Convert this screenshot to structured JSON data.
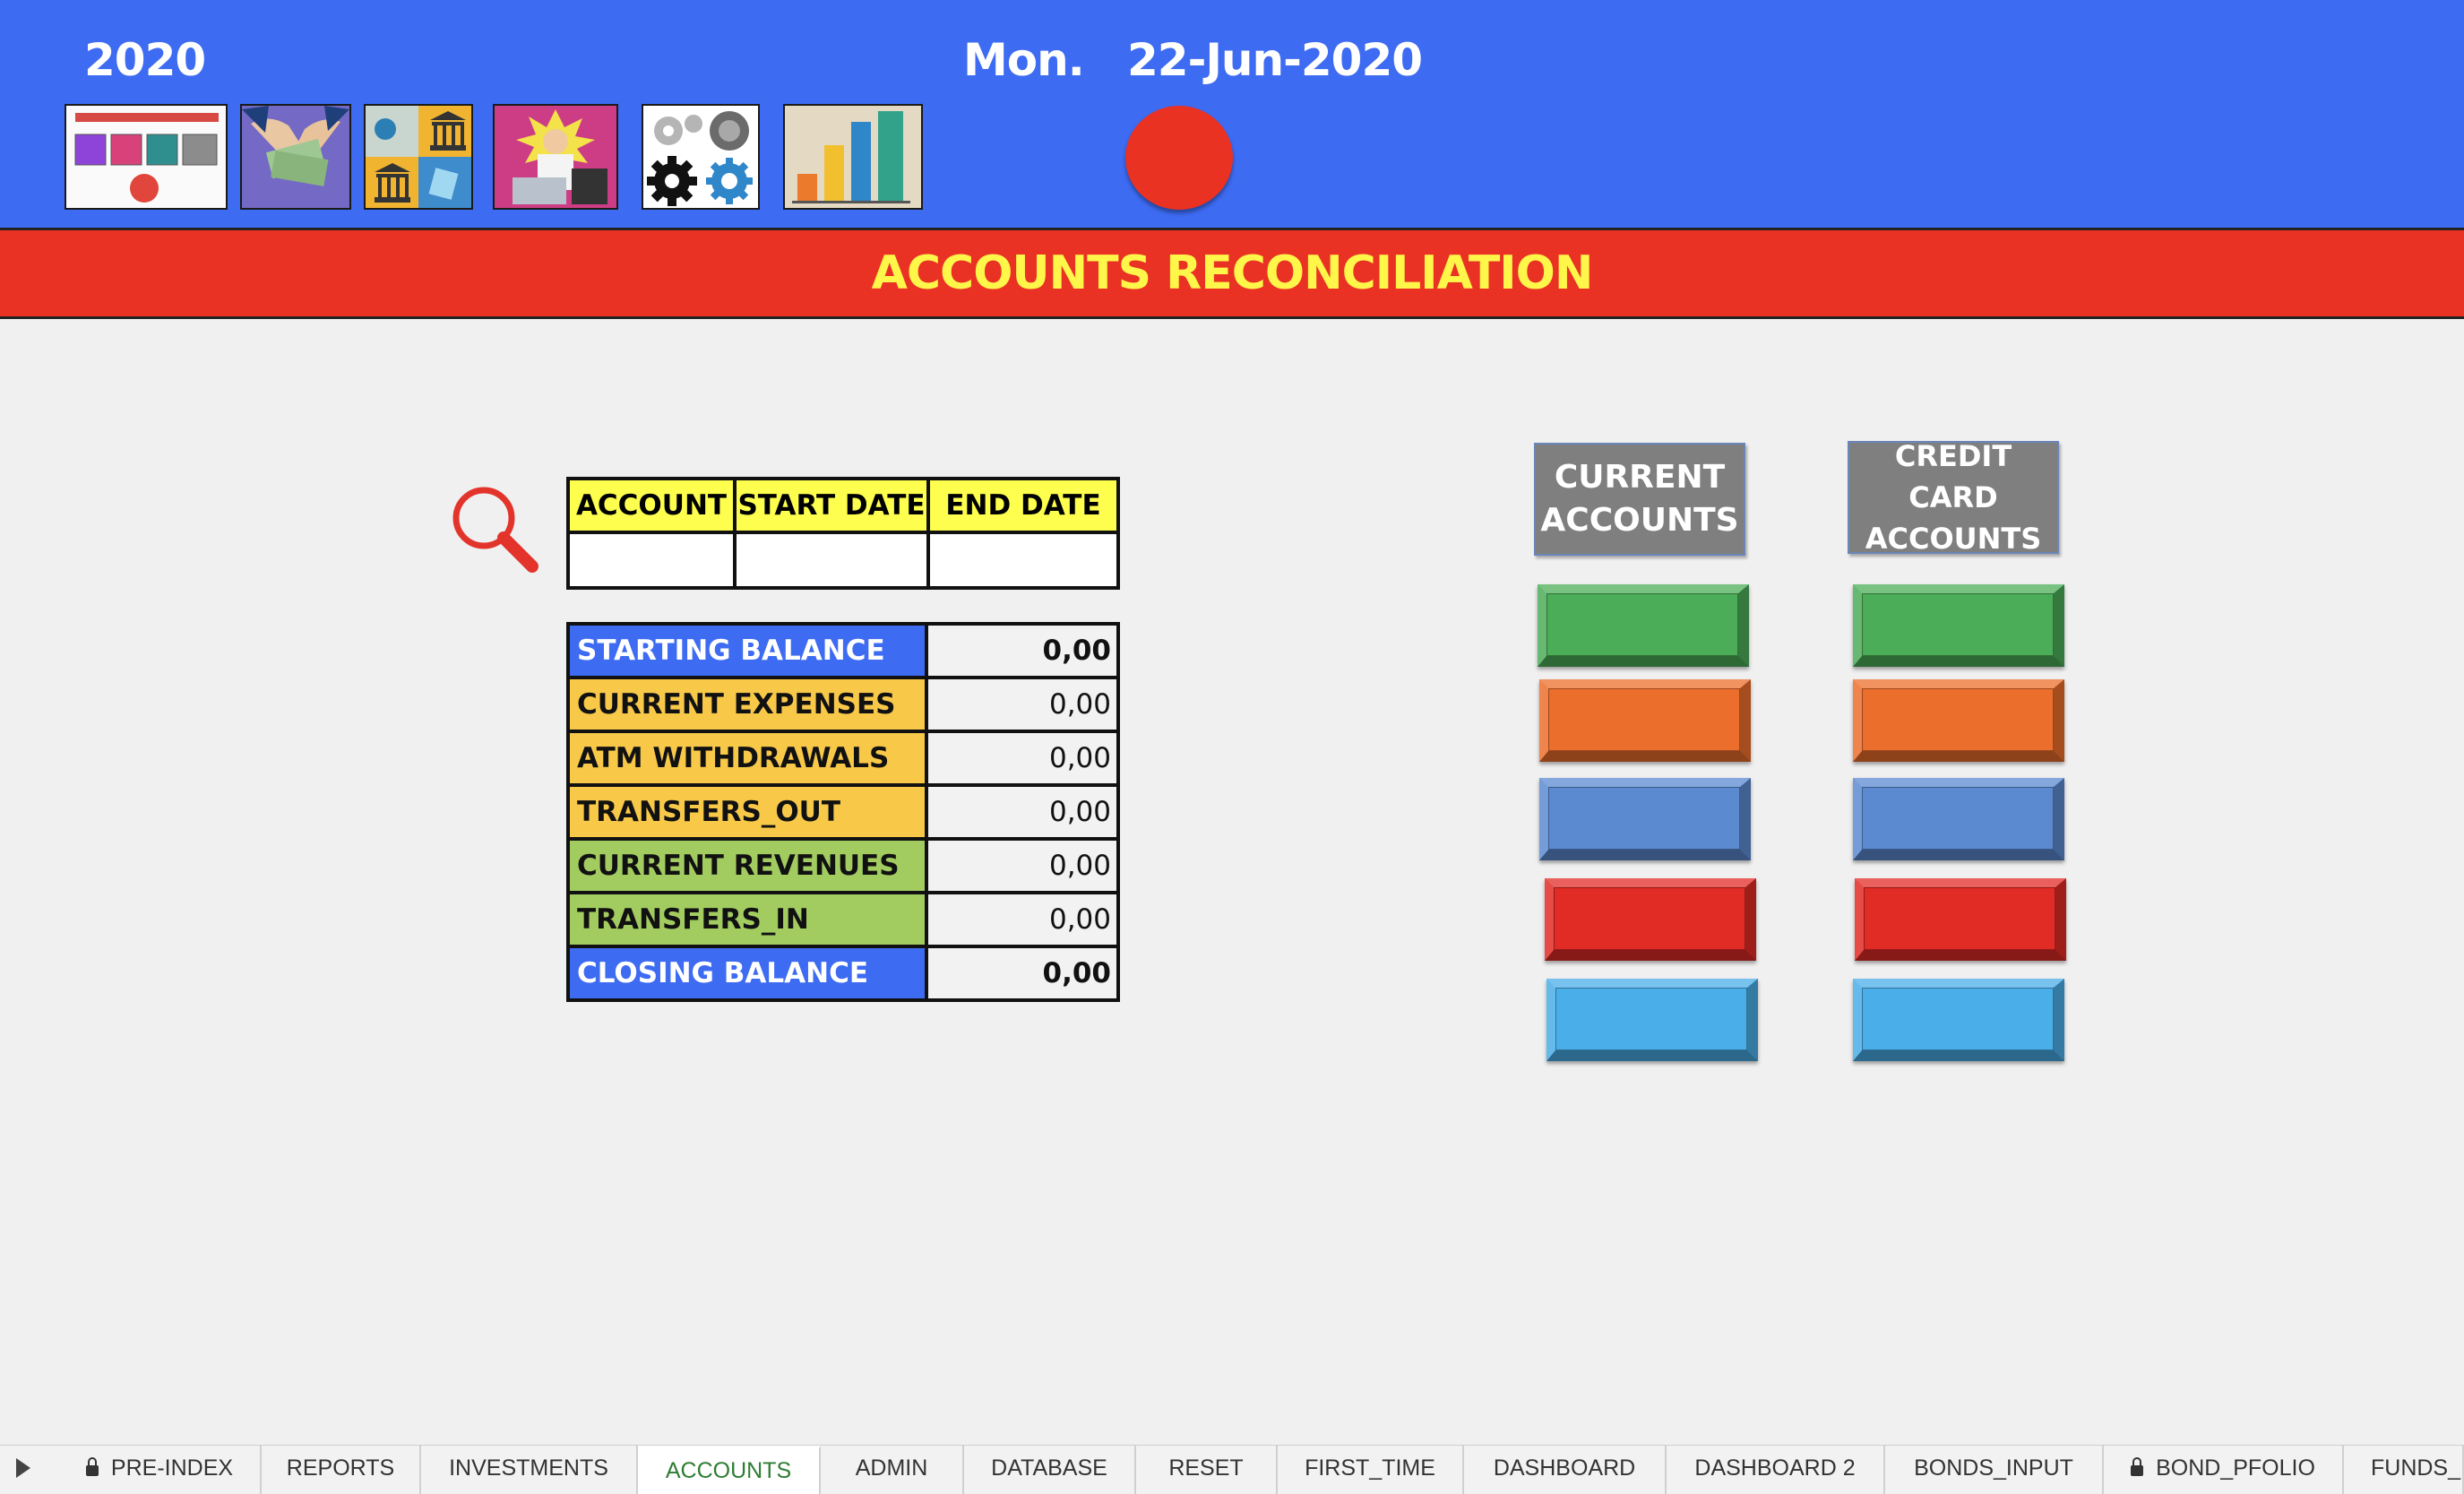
{
  "header": {
    "year": "2020",
    "day": "Mon.",
    "date": "22-Jun-2020",
    "status_color": "#e93222"
  },
  "nav_icons": [
    "dashboard-icon",
    "money-icon",
    "banks-icon",
    "stress-icon",
    "settings-icon",
    "bar-chart-icon"
  ],
  "title": "ACCOUNTS RECONCILIATION",
  "filter": {
    "headers": [
      "ACCOUNT",
      "START DATE",
      "END DATE"
    ],
    "values": [
      "",
      "",
      ""
    ]
  },
  "balances": [
    {
      "label": "STARTING BALANCE",
      "value": "0,00",
      "color": "#3d6bf2",
      "text_color": "#ffffff"
    },
    {
      "label": "CURRENT EXPENSES",
      "value": "0,00",
      "color": "#f8c849",
      "text_color": "#111111"
    },
    {
      "label": "ATM WITHDRAWALS",
      "value": "0,00",
      "color": "#f8c849",
      "text_color": "#111111"
    },
    {
      "label": "TRANSFERS_OUT",
      "value": "0,00",
      "color": "#f8c849",
      "text_color": "#111111"
    },
    {
      "label": "CURRENT REVENUES",
      "value": "0,00",
      "color": "#a2cc60",
      "text_color": "#111111"
    },
    {
      "label": "TRANSFERS_IN",
      "value": "0,00",
      "color": "#a2cc60",
      "text_color": "#111111"
    },
    {
      "label": "CLOSING BALANCE",
      "value": "0,00",
      "color": "#3d6bf2",
      "text_color": "#ffffff"
    }
  ],
  "columns": {
    "current": {
      "line1": "CURRENT",
      "line2": "ACCOUNTS"
    },
    "credit": {
      "line1": "CREDIT CARD",
      "line2": "ACCOUNTS"
    }
  },
  "button_colors": [
    "#4cad58",
    "#ec6e2c",
    "#5b8ad1",
    "#e12b25",
    "#4aaee9"
  ],
  "sheet_tabs": [
    "PRE-INDEX",
    "REPORTS",
    "INVESTMENTS",
    "ACCOUNTS",
    "ADMIN",
    "DATABASE",
    "RESET",
    "FIRST_TIME",
    "DASHBOARD",
    "DASHBOARD 2",
    "BONDS_INPUT",
    "BOND_PFOLIO",
    "FUNDS_I"
  ],
  "active_tab": "ACCOUNTS",
  "locked_tabs": [
    "PRE-INDEX",
    "BOND_PFOLIO"
  ]
}
